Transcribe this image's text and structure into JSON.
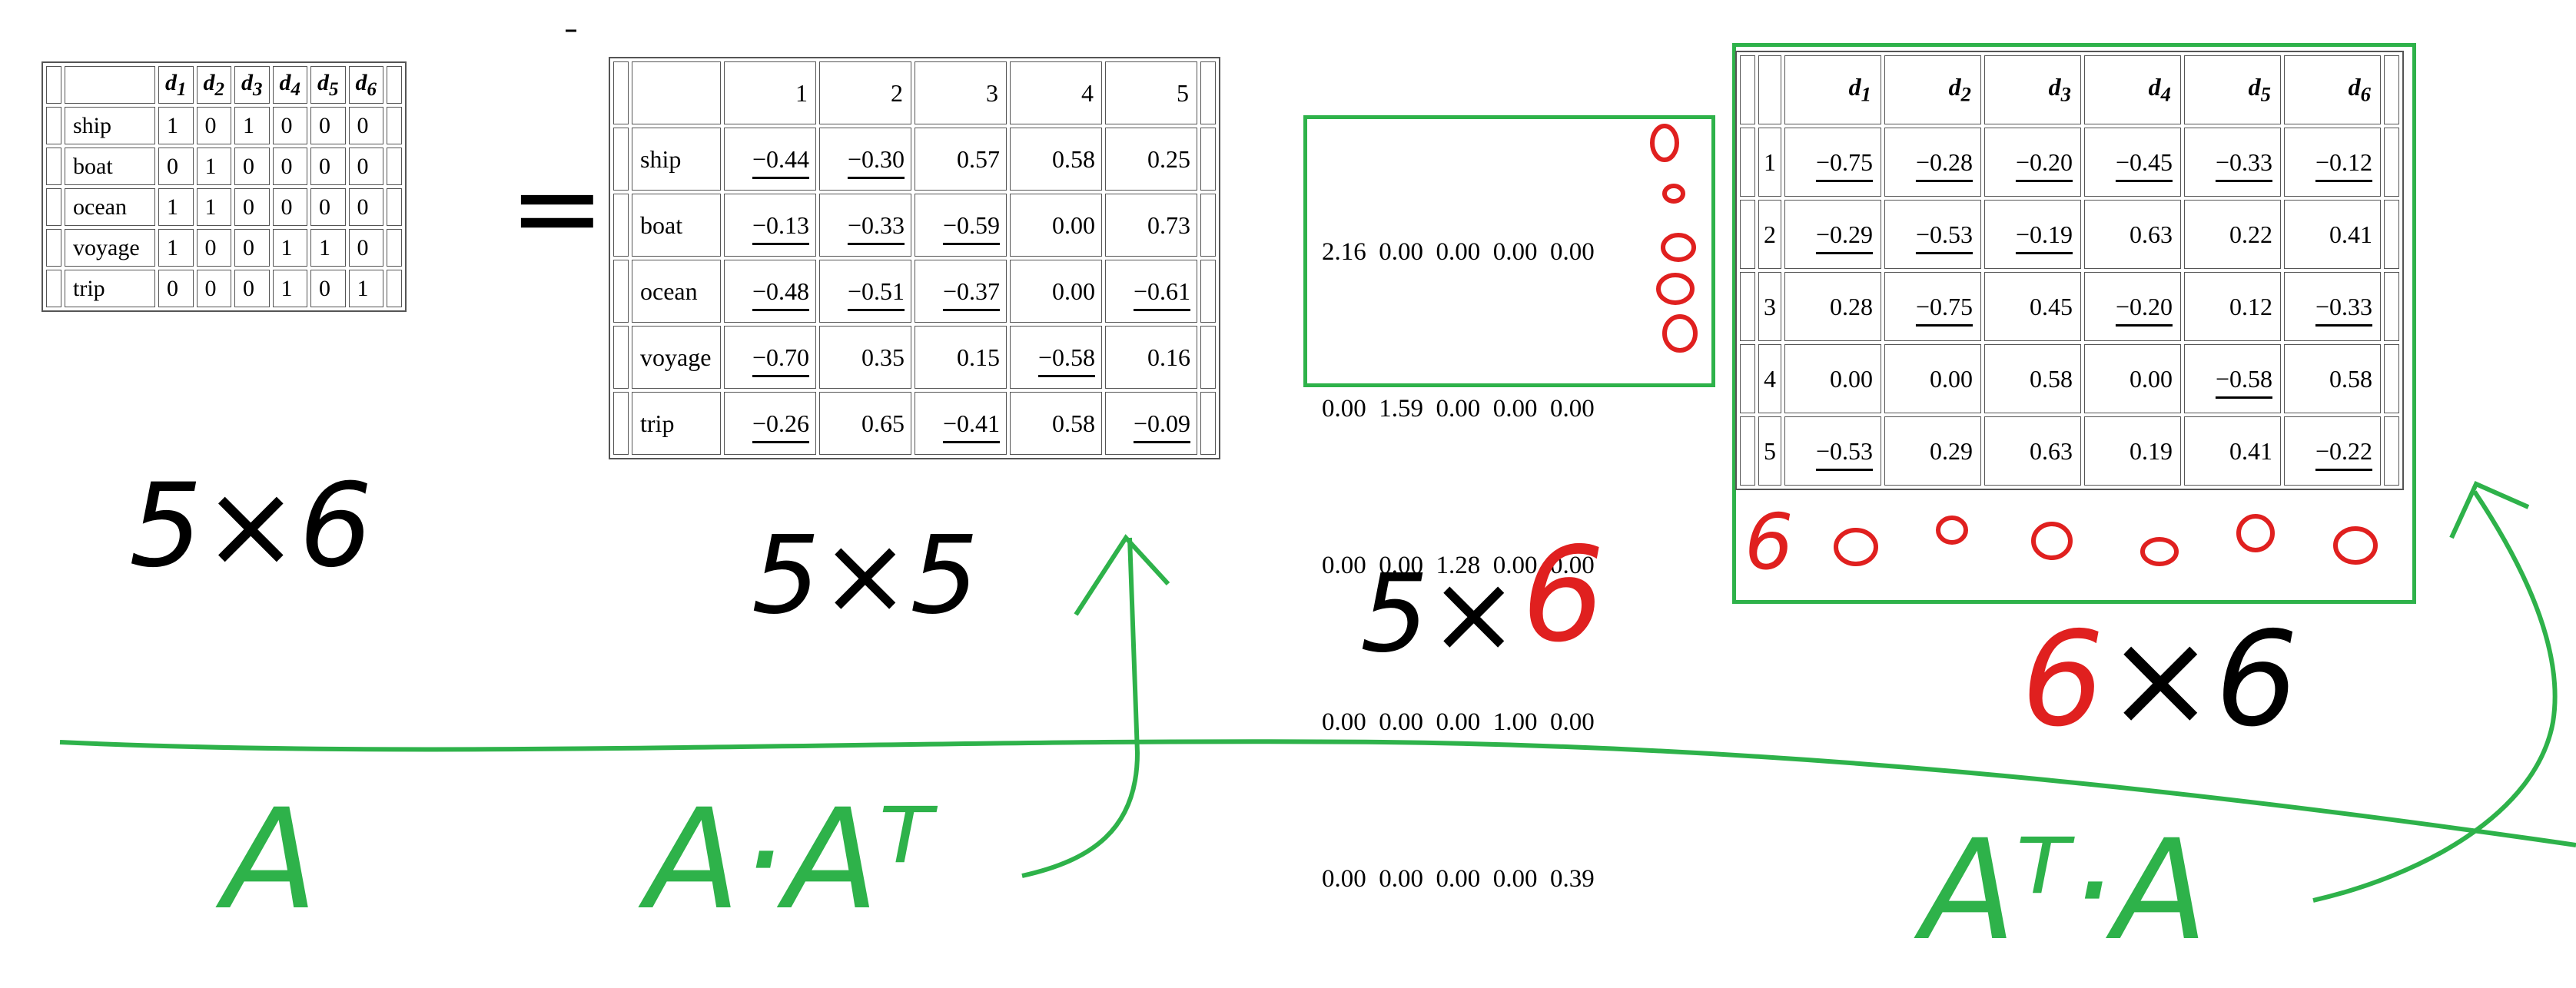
{
  "matrix_A": {
    "columns": [
      "d1",
      "d2",
      "d3",
      "d4",
      "d5",
      "d6"
    ],
    "rows": [
      {
        "label": "ship",
        "values": [
          "1",
          "0",
          "1",
          "0",
          "0",
          "0"
        ]
      },
      {
        "label": "boat",
        "values": [
          "0",
          "1",
          "0",
          "0",
          "0",
          "0"
        ]
      },
      {
        "label": "ocean",
        "values": [
          "1",
          "1",
          "0",
          "0",
          "0",
          "0"
        ]
      },
      {
        "label": "voyage",
        "values": [
          "1",
          "0",
          "0",
          "1",
          "1",
          "0"
        ]
      },
      {
        "label": "trip",
        "values": [
          "0",
          "0",
          "0",
          "1",
          "0",
          "1"
        ]
      }
    ]
  },
  "matrix_U": {
    "columns": [
      "1",
      "2",
      "3",
      "4",
      "5"
    ],
    "rows": [
      {
        "label": "ship",
        "values": [
          "−0.44",
          "−0.30",
          "0.57",
          "0.58",
          "0.25"
        ]
      },
      {
        "label": "boat",
        "values": [
          "−0.13",
          "−0.33",
          "−0.59",
          "0.00",
          "0.73"
        ]
      },
      {
        "label": "ocean",
        "values": [
          "−0.48",
          "−0.51",
          "−0.37",
          "0.00",
          "−0.61"
        ]
      },
      {
        "label": "voyage",
        "values": [
          "−0.70",
          "0.35",
          "0.15",
          "−0.58",
          "0.16"
        ]
      },
      {
        "label": "trip",
        "values": [
          "−0.26",
          "0.65",
          "−0.41",
          "0.58",
          "−0.09"
        ]
      }
    ]
  },
  "matrix_Sigma": {
    "rows": [
      "2.16  0.00  0.00  0.00  0.00",
      "0.00  1.59  0.00  0.00  0.00",
      "0.00  0.00  1.28  0.00  0.00",
      "0.00  0.00  0.00  1.00  0.00",
      "0.00  0.00  0.00  0.00  0.39"
    ]
  },
  "matrix_V": {
    "columns": [
      "d1",
      "d2",
      "d3",
      "d4",
      "d5",
      "d6"
    ],
    "rows": [
      {
        "label": "1",
        "values": [
          "−0.75",
          "−0.28",
          "−0.20",
          "−0.45",
          "−0.33",
          "−0.12"
        ]
      },
      {
        "label": "2",
        "values": [
          "−0.29",
          "−0.53",
          "−0.19",
          "0.63",
          "0.22",
          "0.41"
        ]
      },
      {
        "label": "3",
        "values": [
          "0.28",
          "−0.75",
          "0.45",
          "−0.20",
          "0.12",
          "−0.33"
        ]
      },
      {
        "label": "4",
        "values": [
          "0.00",
          "0.00",
          "0.58",
          "0.00",
          "−0.58",
          "0.58"
        ]
      },
      {
        "label": "5",
        "values": [
          "−0.53",
          "0.29",
          "0.63",
          "0.19",
          "0.41",
          "−0.22"
        ]
      }
    ]
  },
  "annotations": {
    "equals": "=",
    "dim_A": "5×6",
    "dim_U": "5×5",
    "dim_Sigma_left": "5×",
    "dim_Sigma_right": "6",
    "dim_V_left": "6",
    "dim_V_right": "×6",
    "label_A": "A",
    "label_AAT": "A·Aᵀ",
    "label_ATA": "Aᵀ·A",
    "extra_six": "6"
  },
  "colors": {
    "green": "#2eb24a",
    "red": "#e0201f",
    "ink": "#000000"
  }
}
